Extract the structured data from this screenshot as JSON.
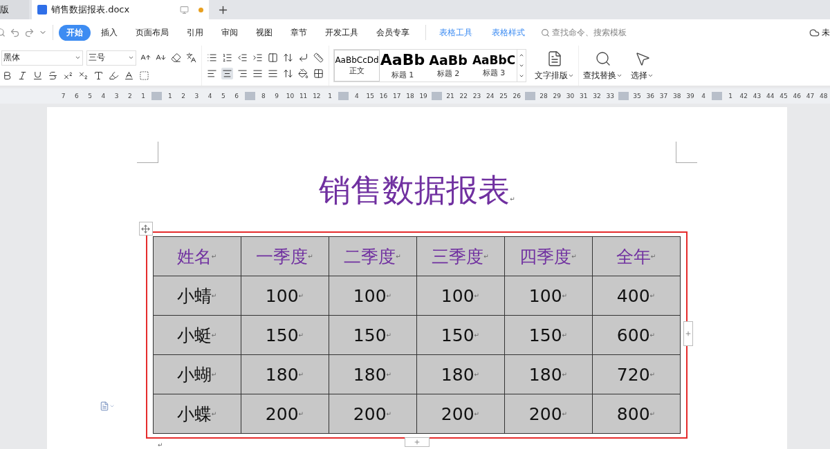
{
  "tabs": [
    {
      "label": "版",
      "selected": false
    },
    {
      "label": "销售数据报表.docx",
      "selected": true,
      "unsaved": true
    }
  ],
  "menu": [
    {
      "label": "开始",
      "selected": true,
      "kind": "main"
    },
    {
      "label": "插入",
      "selected": false,
      "kind": "main"
    },
    {
      "label": "页面布局",
      "selected": false,
      "kind": "main"
    },
    {
      "label": "引用",
      "selected": false,
      "kind": "main"
    },
    {
      "label": "审阅",
      "selected": false,
      "kind": "main"
    },
    {
      "label": "视图",
      "selected": false,
      "kind": "main"
    },
    {
      "label": "章节",
      "selected": false,
      "kind": "main"
    },
    {
      "label": "开发工具",
      "selected": false,
      "kind": "main"
    },
    {
      "label": "会员专享",
      "selected": false,
      "kind": "main"
    },
    {
      "label": "表格工具",
      "selected": false,
      "kind": "context"
    },
    {
      "label": "表格样式",
      "selected": false,
      "kind": "context"
    }
  ],
  "command_search": {
    "placeholder": "查找命令、搜索模板"
  },
  "sync_status": "未",
  "font": {
    "family": "黑体",
    "size": "三号"
  },
  "styles": [
    {
      "preview": "AaBbCcDd",
      "label": "正文",
      "kind": "body",
      "selected": true
    },
    {
      "preview": "AaBb",
      "label": "标题 1",
      "kind": "h1",
      "selected": false
    },
    {
      "preview": "AaBb",
      "label": "标题 2",
      "kind": "h2",
      "selected": false
    },
    {
      "preview": "AaBbC",
      "label": "标题 3",
      "kind": "h3",
      "selected": false
    }
  ],
  "big_buttons": [
    {
      "label": "文字排版",
      "kind": "layout"
    },
    {
      "label": "查找替换",
      "kind": "find"
    },
    {
      "label": "选择",
      "kind": "select"
    }
  ],
  "ruler": [
    {
      "t": "7"
    },
    {
      "t": "6"
    },
    {
      "t": "5"
    },
    {
      "t": "4"
    },
    {
      "t": "3"
    },
    {
      "t": "2"
    },
    {
      "t": "1"
    },
    {
      "kind": "marker"
    },
    {
      "t": "1"
    },
    {
      "t": "2"
    },
    {
      "t": "3"
    },
    {
      "t": "4"
    },
    {
      "t": "5"
    },
    {
      "t": "6"
    },
    {
      "kind": "marker"
    },
    {
      "t": "8"
    },
    {
      "t": "9"
    },
    {
      "t": "10"
    },
    {
      "t": "11"
    },
    {
      "t": "12"
    },
    {
      "t": "1"
    },
    {
      "kind": "marker"
    },
    {
      "t": "4"
    },
    {
      "t": "15"
    },
    {
      "t": "16"
    },
    {
      "t": "17"
    },
    {
      "t": "18"
    },
    {
      "t": "19"
    },
    {
      "kind": "marker"
    },
    {
      "t": "21"
    },
    {
      "t": "22"
    },
    {
      "t": "23"
    },
    {
      "t": "24"
    },
    {
      "t": "25"
    },
    {
      "t": "26"
    },
    {
      "kind": "marker"
    },
    {
      "t": "28"
    },
    {
      "t": "29"
    },
    {
      "t": "30"
    },
    {
      "t": "31"
    },
    {
      "t": "32"
    },
    {
      "t": "33"
    },
    {
      "kind": "marker"
    },
    {
      "t": "35"
    },
    {
      "t": "36"
    },
    {
      "t": "37"
    },
    {
      "t": "38"
    },
    {
      "t": "39"
    },
    {
      "t": "4"
    },
    {
      "kind": "marker"
    },
    {
      "t": "1"
    },
    {
      "t": "42"
    },
    {
      "t": "43"
    },
    {
      "t": "44"
    },
    {
      "t": "45"
    },
    {
      "t": "46"
    },
    {
      "t": "47"
    },
    {
      "t": "48"
    }
  ],
  "document": {
    "title": "销售数据报表",
    "title_mark": "↵",
    "table": {
      "selected": true,
      "header": [
        {
          "t": "姓名",
          "m": "↵"
        },
        {
          "t": "一季度",
          "m": "↵"
        },
        {
          "t": "二季度",
          "m": "↵"
        },
        {
          "t": "三季度",
          "m": "↵"
        },
        {
          "t": "四季度",
          "m": "↵"
        },
        {
          "t": "全年",
          "m": "↵"
        }
      ],
      "rows": [
        [
          {
            "t": "小蜻",
            "m": "↵"
          },
          {
            "t": "100",
            "m": "↵"
          },
          {
            "t": "100",
            "m": "↵"
          },
          {
            "t": "100",
            "m": "↵"
          },
          {
            "t": "100",
            "m": "↵"
          },
          {
            "t": "400",
            "m": "↵"
          }
        ],
        [
          {
            "t": "小蜓",
            "m": "↵"
          },
          {
            "t": "150",
            "m": "↵"
          },
          {
            "t": "150",
            "m": "↵"
          },
          {
            "t": "150",
            "m": "↵"
          },
          {
            "t": "150",
            "m": "↵"
          },
          {
            "t": "600",
            "m": "↵"
          }
        ],
        [
          {
            "t": "小蝴",
            "m": "↵"
          },
          {
            "t": "180",
            "m": "↵"
          },
          {
            "t": "180",
            "m": "↵"
          },
          {
            "t": "180",
            "m": "↵"
          },
          {
            "t": "180",
            "m": "↵"
          },
          {
            "t": "720",
            "m": "↵"
          }
        ],
        [
          {
            "t": "小蝶",
            "m": "↵"
          },
          {
            "t": "200",
            "m": "↵"
          },
          {
            "t": "200",
            "m": "↵"
          },
          {
            "t": "200",
            "m": "↵"
          },
          {
            "t": "200",
            "m": "↵"
          },
          {
            "t": "800",
            "m": "↵"
          }
        ]
      ]
    },
    "end_mark": "↵"
  }
}
